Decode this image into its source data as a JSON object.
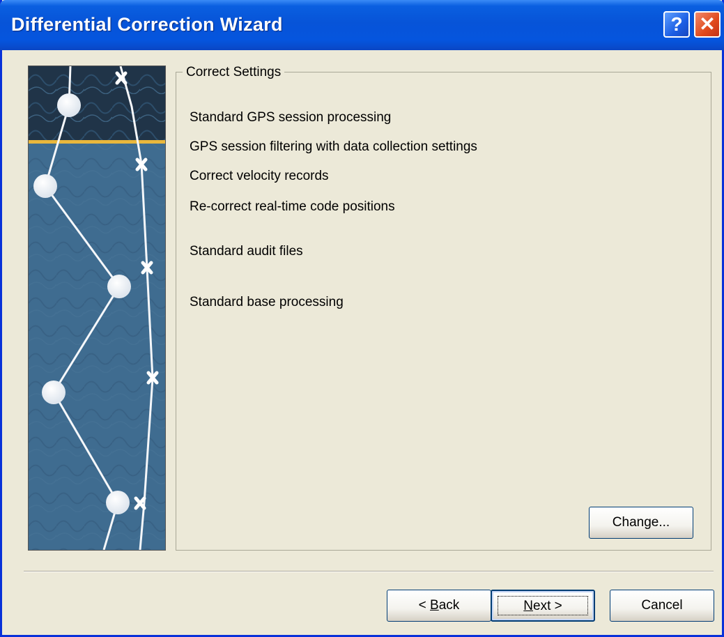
{
  "window": {
    "title": "Differential Correction Wizard",
    "help_label": "?",
    "close_label": "✕"
  },
  "group": {
    "legend": "Correct Settings",
    "settings": [
      "Standard GPS session processing",
      "GPS session filtering with data collection settings",
      "Correct velocity records",
      "Re-correct real-time code positions",
      "Standard audit files",
      "Standard base processing"
    ],
    "change_label": "Change..."
  },
  "footer": {
    "back_prefix": "< ",
    "back_mnemonic": "B",
    "back_rest": "ack",
    "next_mnemonic": "N",
    "next_rest": "ext >",
    "cancel_label": "Cancel"
  },
  "icons": {
    "help": "help-icon",
    "close": "close-icon",
    "art": "gps-route-illustration"
  },
  "colors": {
    "titlebar": "#0754d8",
    "dialog_bg": "#ece9d8",
    "art_band": "#e9b73c"
  }
}
